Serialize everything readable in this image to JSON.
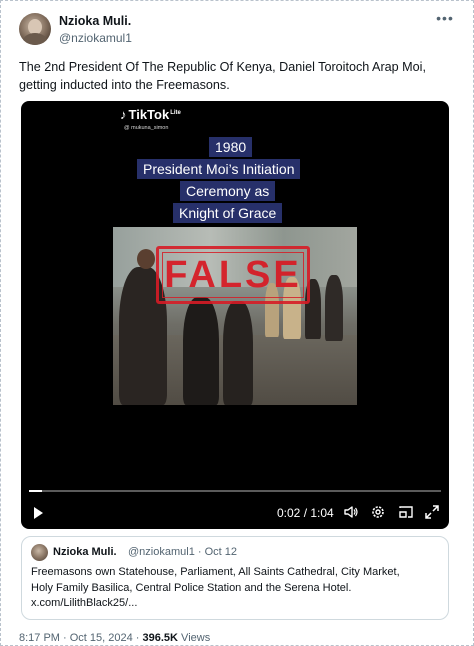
{
  "tweet": {
    "display_name": "Nzioka Muli.",
    "handle": "@nziokamul1",
    "text": "The 2nd President Of The Republic Of Kenya, Daniel Toroitoch Arap Moi, getting inducted into the Freemasons.",
    "more_icon": "more-dots-icon"
  },
  "video": {
    "tiktok_logo": "TikTok",
    "tiktok_lite": "Lite",
    "tiktok_user": "@ mukuna_simon",
    "caption_lines": [
      "1980",
      "President Moi’s Initiation",
      "Ceremony as",
      "Knight of Grace"
    ],
    "stamp_text": "FALSE",
    "stamp_color": "#d61c26",
    "time_display": "0:02 / 1:04",
    "progress_fraction": 0.031,
    "controls": [
      "play-icon",
      "volume-icon",
      "settings-icon",
      "pip-icon",
      "fullscreen-icon"
    ]
  },
  "quote": {
    "display_name": "Nzioka Muli.",
    "handle": "@nziokamul1",
    "separator": "·",
    "date": "Oct 12",
    "text_line1": "Freemasons own Statehouse, Parliament, All Saints Cathedral, City Market,",
    "text_line2": "Holy Family Basilica, Central Police Station and the Serena Hotel.",
    "text_line3": "x.com/LilithBlack25/..."
  },
  "footer": {
    "timestamp": "8:17 PM · Oct 15, 2024 · ",
    "views_count": "396.5K",
    "views_label": " Views"
  },
  "colors": {
    "text_primary": "#0f1419",
    "text_secondary": "#536471",
    "caption_bg": "#27306a",
    "border": "#cfd9de"
  }
}
